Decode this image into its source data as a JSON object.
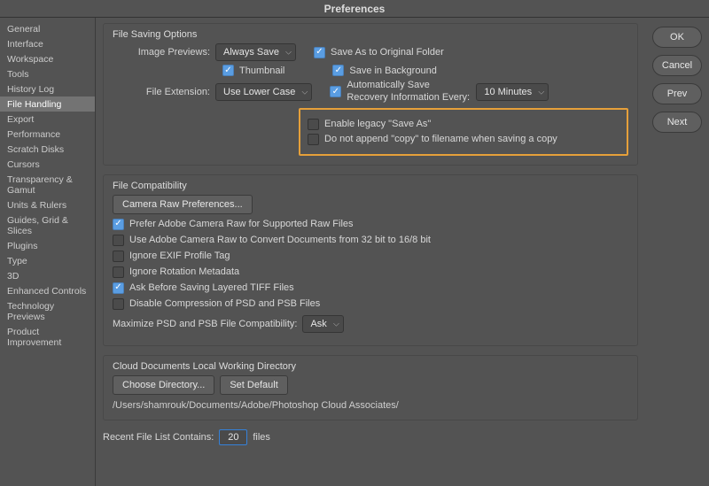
{
  "window": {
    "title": "Preferences"
  },
  "buttons": {
    "ok": "OK",
    "cancel": "Cancel",
    "prev": "Prev",
    "next": "Next"
  },
  "sidebar": {
    "items": [
      {
        "label": "General"
      },
      {
        "label": "Interface"
      },
      {
        "label": "Workspace"
      },
      {
        "label": "Tools"
      },
      {
        "label": "History Log"
      },
      {
        "label": "File Handling"
      },
      {
        "label": "Export"
      },
      {
        "label": "Performance"
      },
      {
        "label": "Scratch Disks"
      },
      {
        "label": "Cursors"
      },
      {
        "label": "Transparency & Gamut"
      },
      {
        "label": "Units & Rulers"
      },
      {
        "label": "Guides, Grid & Slices"
      },
      {
        "label": "Plugins"
      },
      {
        "label": "Type"
      },
      {
        "label": "3D"
      },
      {
        "label": "Enhanced Controls"
      },
      {
        "label": "Technology Previews"
      },
      {
        "label": "Product Improvement"
      }
    ],
    "selected_index": 5
  },
  "file_saving": {
    "title": "File Saving Options",
    "image_previews_label": "Image Previews:",
    "image_previews_value": "Always Save",
    "thumbnail_label": "Thumbnail",
    "thumbnail_checked": true,
    "save_orig_label": "Save As to Original Folder",
    "save_orig_checked": true,
    "save_bg_label": "Save in Background",
    "save_bg_checked": true,
    "file_ext_label": "File Extension:",
    "file_ext_value": "Use Lower Case",
    "auto_save_label": "Automatically Save Recovery Information Every:",
    "auto_save_checked": true,
    "auto_save_value": "10 Minutes",
    "legacy_label": "Enable legacy \"Save As\"",
    "legacy_checked": false,
    "no_copy_label": "Do not append \"copy\" to filename when saving a copy",
    "no_copy_checked": false
  },
  "file_compat": {
    "title": "File Compatibility",
    "camera_raw_btn": "Camera Raw Preferences...",
    "prefer_raw_label": "Prefer Adobe Camera Raw for Supported Raw Files",
    "prefer_raw_checked": true,
    "convert_32_label": "Use Adobe Camera Raw to Convert Documents from 32 bit to 16/8 bit",
    "convert_32_checked": false,
    "ignore_exif_label": "Ignore EXIF Profile Tag",
    "ignore_exif_checked": false,
    "ignore_rot_label": "Ignore Rotation Metadata",
    "ignore_rot_checked": false,
    "ask_tiff_label": "Ask Before Saving Layered TIFF Files",
    "ask_tiff_checked": true,
    "disable_comp_label": "Disable Compression of PSD and PSB Files",
    "disable_comp_checked": false,
    "maximize_label": "Maximize PSD and PSB File Compatibility:",
    "maximize_value": "Ask"
  },
  "cloud": {
    "title": "Cloud Documents Local Working Directory",
    "choose_btn": "Choose Directory...",
    "default_btn": "Set Default",
    "path": "/Users/shamrouk/Documents/Adobe/Photoshop Cloud Associates/"
  },
  "recent": {
    "label_pre": "Recent File List Contains:",
    "value": "20",
    "label_post": "files"
  }
}
